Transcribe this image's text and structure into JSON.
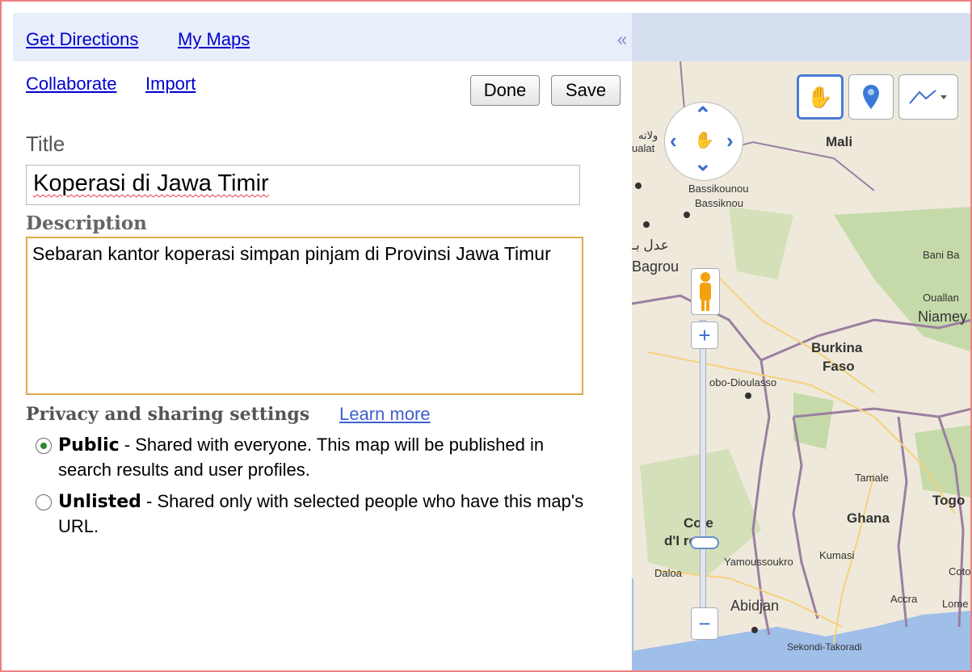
{
  "topbar": {
    "get_directions": "Get Directions",
    "my_maps": "My Maps",
    "collapse": "«"
  },
  "actions": {
    "collaborate": "Collaborate",
    "import": "Import",
    "done": "Done",
    "save": "Save"
  },
  "form": {
    "title_label": "Title",
    "title_value": "Koperasi di Jawa Timir",
    "description_label": "Description",
    "description_value": "Sebaran kantor koperasi simpan pinjam di Provinsi Jawa Timur"
  },
  "privacy": {
    "heading": "Privacy and sharing settings",
    "learn_more": "Learn more",
    "options": [
      {
        "name": "Public",
        "text": " - Shared with everyone. This map will be published in search results and user profiles.",
        "selected": true
      },
      {
        "name": "Unlisted",
        "text": " - Shared only with selected people who have this map's URL.",
        "selected": false
      }
    ]
  },
  "map": {
    "labels": [
      "Mali",
      "Bassikounou",
      "Bassiknou",
      "Bagrou",
      "Bani Ba",
      "Ouallan",
      "Niamey",
      "Burkina",
      "Faso",
      "obo-Dioulasso",
      "Tamale",
      "Togo",
      "Ghana",
      "Co  e",
      "d'I    re",
      "Yamoussoukro",
      "Kumasi",
      "Daloa",
      "Coto",
      "Accra",
      "Lome",
      "Abidjan",
      "Sekondi-Takoradi",
      "ولاته",
      "ualat",
      "عدل بـ"
    ],
    "tools": [
      "hand-tool",
      "marker-tool",
      "line-tool"
    ]
  },
  "colors": {
    "link": "#0000cc",
    "topbar": "#e8eefa",
    "textarea_border": "#e0a94a",
    "frame_border": "#f08080"
  }
}
